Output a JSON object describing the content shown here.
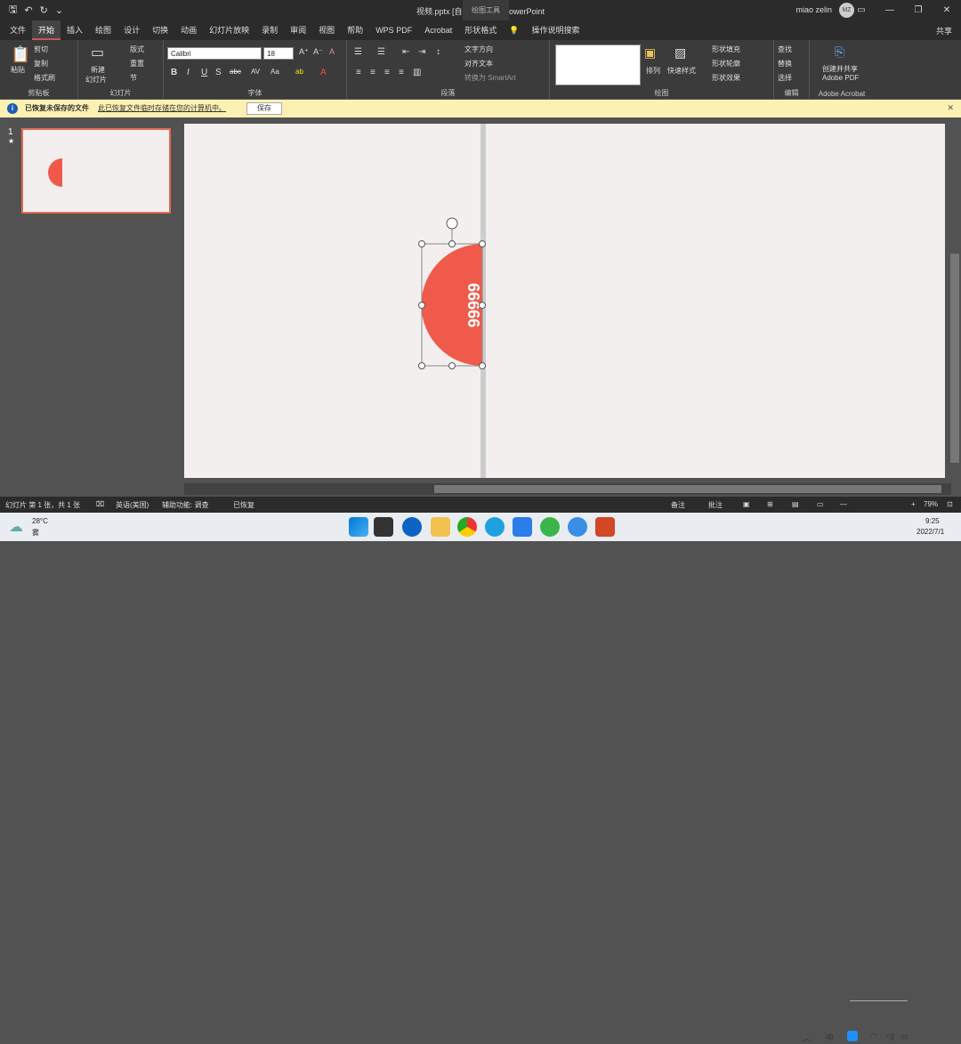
{
  "titlebar": {
    "doc_title": "视频.pptx [自动保存的] - PowerPoint",
    "context_title": "绘图工具",
    "user_name": "miao zelin",
    "avatar_initials": "MZ"
  },
  "tabs": [
    "文件",
    "开始",
    "插入",
    "绘图",
    "设计",
    "切换",
    "动画",
    "幻灯片放映",
    "录制",
    "审阅",
    "视图",
    "帮助",
    "WPS PDF",
    "Acrobat",
    "形状格式"
  ],
  "search_label": "操作说明搜索",
  "share_label": "共享",
  "ribbon": {
    "clipboard": {
      "paste": "粘贴",
      "cut": "剪切",
      "copy": "复制",
      "format_painter": "格式刷",
      "label": "剪贴板"
    },
    "slides": {
      "new_slide": "新建",
      "new_slide2": "幻灯片",
      "layout": "版式",
      "reset": "重置",
      "section": "节",
      "label": "幻灯片"
    },
    "font": {
      "name": "Calibri",
      "size": "18",
      "label": "字体"
    },
    "paragraph": {
      "text_dir": "文字方向",
      "align_text": "对齐文本",
      "smartart": "转换为 SmartArt",
      "label": "段落"
    },
    "drawing": {
      "arrange": "排列",
      "quick_styles": "快速样式",
      "fill": "形状填充",
      "outline": "形状轮廓",
      "effects": "形状效果",
      "label": "绘图"
    },
    "editing": {
      "find": "查找",
      "replace": "替换",
      "select": "选择",
      "label": "编辑"
    },
    "acrobat": {
      "create": "创建并共享",
      "create2": "Adobe PDF",
      "label": "Adobe Acrobat"
    }
  },
  "infobar": {
    "title": "已恢复未保存的文件",
    "message": "此已恢复文件临时存储在您的计算机中。",
    "save_button": "保存"
  },
  "thumbnail": {
    "slide_number": "1",
    "star": "★"
  },
  "slide": {
    "shape_text": "66666",
    "shape_color": "#f05a4a"
  },
  "statusbar": {
    "slide_info": "幻灯片 第 1 张，共 1 张",
    "language": "英语(美国)",
    "accessibility": "辅助功能: 调查",
    "recovered": "已恢复",
    "notes": "备注",
    "comments": "批注",
    "zoom": "79%"
  },
  "taskbar": {
    "temperature": "28°C",
    "weather": "雾",
    "time": "9:25",
    "date": "2022/7/1"
  }
}
